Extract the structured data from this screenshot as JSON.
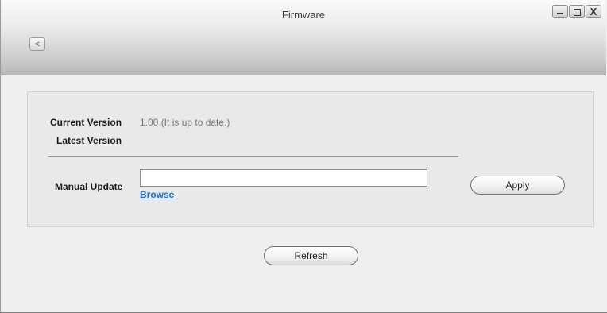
{
  "window": {
    "title": "Firmware",
    "back_label": "<",
    "controls": {
      "close_label": "X"
    }
  },
  "firmware": {
    "current_version_label": "Current Version",
    "current_version_value": "1.00 (It is up to date.)",
    "latest_version_label": "Latest Version",
    "manual_update_label": "Manual Update",
    "manual_update_value": "",
    "browse_label": "Browse",
    "apply_label": "Apply"
  },
  "footer": {
    "refresh_label": "Refresh"
  }
}
